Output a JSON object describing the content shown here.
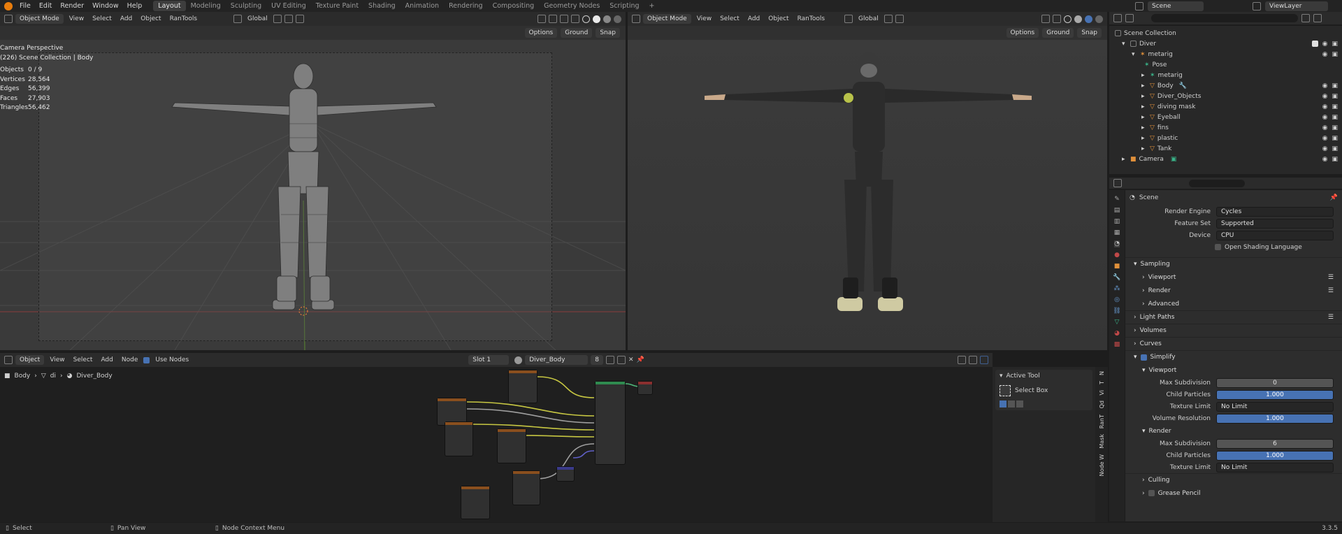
{
  "menu": {
    "items": [
      "File",
      "Edit",
      "Render",
      "Window",
      "Help"
    ]
  },
  "workspaces": {
    "active": "Layout",
    "items": [
      "Layout",
      "Modeling",
      "Sculpting",
      "UV Editing",
      "Texture Paint",
      "Shading",
      "Animation",
      "Rendering",
      "Compositing",
      "Geometry Nodes",
      "Scripting"
    ]
  },
  "topright": {
    "scene": "Scene",
    "view_layer": "ViewLayer"
  },
  "viewport_left": {
    "mode": "Object Mode",
    "menus": [
      "View",
      "Select",
      "Add",
      "Object",
      "RanTools"
    ],
    "orientation": "Global",
    "options": "Options",
    "ground": "Ground",
    "snap": "Snap",
    "title": "Camera Perspective",
    "subtitle": "(226) Scene Collection | Body",
    "stats": [
      {
        "label": "Objects",
        "value": "0 / 9"
      },
      {
        "label": "Vertices",
        "value": "28,564"
      },
      {
        "label": "Edges",
        "value": "56,399"
      },
      {
        "label": "Faces",
        "value": "27,903"
      },
      {
        "label": "Triangles",
        "value": "56,462"
      }
    ]
  },
  "viewport_right": {
    "mode": "Object Mode",
    "menus": [
      "View",
      "Select",
      "Add",
      "Object",
      "RanTools"
    ],
    "orientation": "Global",
    "options": "Options",
    "ground": "Ground",
    "snap": "Snap"
  },
  "outliner": {
    "root": "Scene Collection",
    "items": [
      {
        "name": "Diver",
        "indent": 1
      },
      {
        "name": "metarig",
        "indent": 2
      },
      {
        "name": "Pose",
        "indent": 3
      },
      {
        "name": "metarig",
        "indent": 3
      },
      {
        "name": "Body",
        "indent": 3
      },
      {
        "name": "Diver_Objects",
        "indent": 3
      },
      {
        "name": "diving mask",
        "indent": 3
      },
      {
        "name": "Eyeball",
        "indent": 3
      },
      {
        "name": "fins",
        "indent": 3
      },
      {
        "name": "plastic",
        "indent": 3
      },
      {
        "name": "Tank",
        "indent": 3
      },
      {
        "name": "Camera",
        "indent": 1
      }
    ]
  },
  "properties": {
    "context": "Scene",
    "render_engine": {
      "label": "Render Engine",
      "value": "Cycles"
    },
    "feature_set": {
      "label": "Feature Set",
      "value": "Supported"
    },
    "device": {
      "label": "Device",
      "value": "CPU"
    },
    "osl": "Open Shading Language",
    "sampling": "Sampling",
    "viewport": "Viewport",
    "render": "Render",
    "advanced": "Advanced",
    "light_paths": "Light Paths",
    "volumes": "Volumes",
    "curves": "Curves",
    "simplify": "Simplify",
    "simplify_viewport": "Viewport",
    "v_max_subdivision": {
      "label": "Max Subdivision",
      "value": "0"
    },
    "v_child_particles": {
      "label": "Child Particles",
      "value": "1.000"
    },
    "v_texture_limit": {
      "label": "Texture Limit",
      "value": "No Limit"
    },
    "v_volume_resolution": {
      "label": "Volume Resolution",
      "value": "1.000"
    },
    "simplify_render": "Render",
    "r_max_subdivision": {
      "label": "Max Subdivision",
      "value": "6"
    },
    "r_child_particles": {
      "label": "Child Particles",
      "value": "1.000"
    },
    "r_texture_limit": {
      "label": "Texture Limit",
      "value": "No Limit"
    },
    "culling": "Culling",
    "grease_pencil": "Grease Pencil"
  },
  "node_editor": {
    "type": "Object",
    "menus": [
      "View",
      "Select",
      "Add",
      "Node"
    ],
    "use_nodes": "Use Nodes",
    "slot": "Slot 1",
    "material": "Diver_Body",
    "users": "8",
    "breadcrumb": [
      "Body",
      "di",
      "Diver_Body"
    ],
    "side_tabs": [
      "N",
      "T",
      "Vi",
      "Qd",
      "RanT",
      "Mask",
      "Node W"
    ]
  },
  "tool_panel": {
    "title": "Active Tool",
    "tool": "Select Box"
  },
  "statusbar": {
    "select": "Select",
    "pan": "Pan View",
    "context": "Node Context Menu",
    "version": "3.3.5"
  }
}
